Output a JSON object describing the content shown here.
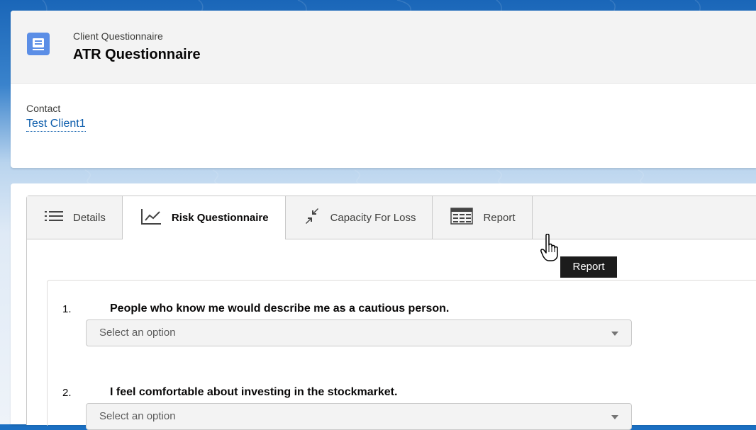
{
  "header": {
    "object_label": "Client Questionnaire",
    "record_title": "ATR Questionnaire",
    "icon": "record-icon",
    "fields": [
      {
        "label": "Contact",
        "value": "Test Client1"
      }
    ]
  },
  "tabs": [
    {
      "label": "Details",
      "icon": "list-icon",
      "active": false
    },
    {
      "label": "Risk Questionnaire",
      "icon": "line-chart-icon",
      "active": true
    },
    {
      "label": "Capacity For Loss",
      "icon": "contract-arrows-icon",
      "active": false
    },
    {
      "label": "Report",
      "icon": "table-report-icon",
      "active": false
    }
  ],
  "questions": [
    {
      "number": "1.",
      "text": "People who know me would describe me as a cautious person.",
      "placeholder": "Select an option"
    },
    {
      "number": "2.",
      "text": "I feel comfortable about investing in the stockmarket.",
      "placeholder": "Select an option"
    }
  ],
  "tooltip": {
    "text": "Report"
  },
  "colors": {
    "brand_blue": "#1b6fc2",
    "link": "#0b5cab",
    "icon_bg": "#5b8ee6"
  }
}
